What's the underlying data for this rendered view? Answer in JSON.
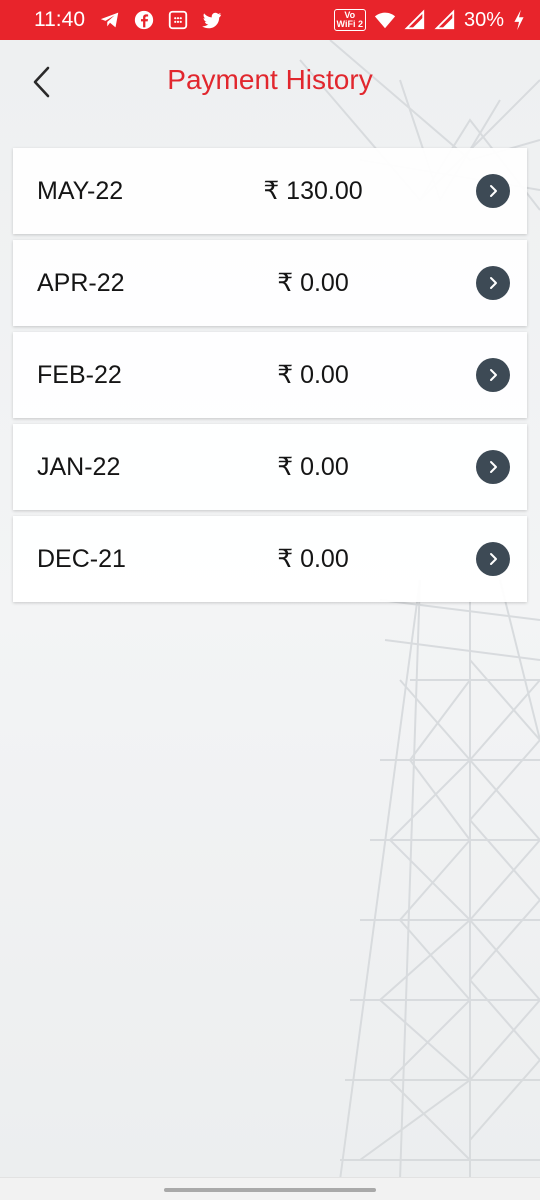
{
  "status_bar": {
    "time": "11:40",
    "notification_icons": [
      "telegram-icon",
      "facebook-icon",
      "calculator-icon",
      "twitter-icon"
    ],
    "vowifi_top": "Vo",
    "vowifi_bottom": "WiFi 2",
    "battery": "30%",
    "color": "#e8242b"
  },
  "header": {
    "title": "Payment History",
    "title_color": "#e1272e",
    "back_icon": "chevron-left-icon"
  },
  "payments": [
    {
      "month": "MAY-22",
      "amount": "₹ 130.00"
    },
    {
      "month": "APR-22",
      "amount": "₹ 0.00"
    },
    {
      "month": "FEB-22",
      "amount": "₹ 0.00"
    },
    {
      "month": "JAN-22",
      "amount": "₹ 0.00"
    },
    {
      "month": "DEC-21",
      "amount": "₹ 0.00"
    }
  ],
  "row_action_icon": "chevron-right-icon"
}
